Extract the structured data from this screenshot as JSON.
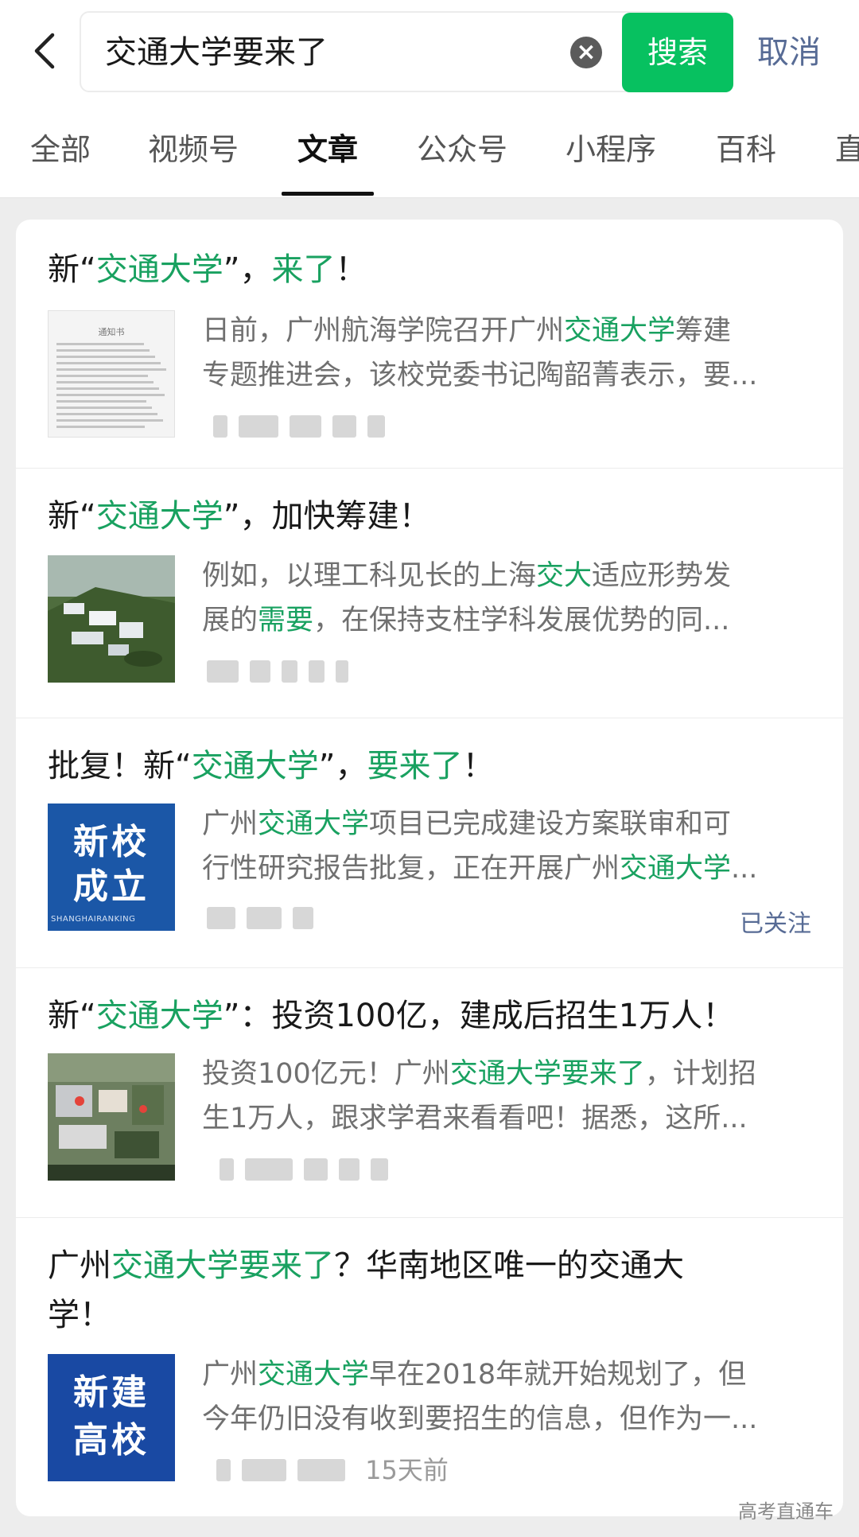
{
  "search": {
    "query": "交通大学要来了",
    "button": "搜索",
    "cancel": "取消"
  },
  "tabs": [
    "全部",
    "视频号",
    "文章",
    "公众号",
    "小程序",
    "百科",
    "直"
  ],
  "active_tab": "文章",
  "results": [
    {
      "title": [
        [
          "新“",
          0
        ],
        [
          "交通大学",
          1
        ],
        [
          "”，",
          0
        ],
        [
          "来了",
          1
        ],
        [
          "！",
          0
        ]
      ],
      "desc": [
        [
          [
            "日前，广州航海学院召开广州",
            0
          ],
          [
            "交通大学",
            1
          ],
          [
            "筹建",
            0
          ]
        ],
        [
          [
            "专题推进会，该校党委书记陶韶菁表示，要...",
            0
          ]
        ]
      ],
      "thumb": "doc",
      "thumb_text": [
        "通知书"
      ]
    },
    {
      "title": [
        [
          "新“",
          0
        ],
        [
          "交通大学",
          1
        ],
        [
          "”，加快筹建！",
          0
        ]
      ],
      "desc": [
        [
          [
            "例如，以理工科见长的上海",
            0
          ],
          [
            "交大",
            1
          ],
          [
            "适应形势发",
            0
          ]
        ],
        [
          [
            "展的",
            0
          ],
          [
            "需要",
            1
          ],
          [
            "，在保持支柱学科发展优势的同...",
            0
          ]
        ]
      ],
      "thumb": "campus"
    },
    {
      "title": [
        [
          "批复！新“",
          0
        ],
        [
          "交通大学",
          1
        ],
        [
          "”，",
          0
        ],
        [
          "要来了",
          1
        ],
        [
          "！",
          0
        ]
      ],
      "desc": [
        [
          [
            "广州",
            0
          ],
          [
            "交通大学",
            1
          ],
          [
            "项目已完成建设方案联审和可",
            0
          ]
        ],
        [
          [
            "行性研究报告批复，正在开展广州",
            0
          ],
          [
            "交通大学",
            1
          ],
          [
            "...",
            0
          ]
        ]
      ],
      "thumb": "badge",
      "thumb_text": [
        "新校",
        "成立"
      ],
      "thumb_caption": "SHANGHAIRANKING",
      "followed": "已关注"
    },
    {
      "title": [
        [
          "新“",
          0
        ],
        [
          "交通大学",
          1
        ],
        [
          "”：投资100亿，建成后招生1万人！",
          0
        ]
      ],
      "desc": [
        [
          [
            "投资100亿元！广州",
            0
          ],
          [
            "交通大学要来了",
            1
          ],
          [
            "，计划招",
            0
          ]
        ],
        [
          [
            "生1万人，跟求学君来看看吧！据悉，这所...",
            0
          ]
        ]
      ],
      "thumb": "campus2"
    },
    {
      "title": [
        [
          "广州",
          0
        ],
        [
          "交通大学要来了",
          1
        ],
        [
          "？华南地区唯一的交通大",
          0
        ]
      ],
      "title2": "学！",
      "desc": [
        [
          [
            "广州",
            0
          ],
          [
            "交通大学",
            1
          ],
          [
            "早在2018年就开始规划了，但",
            0
          ]
        ],
        [
          [
            "今年仍旧没有收到要招生的信息，但作为一...",
            0
          ]
        ]
      ],
      "thumb": "badge2",
      "thumb_text": [
        "新建",
        "高校"
      ],
      "time": "15天前"
    }
  ],
  "watermark": "高考直通车",
  "colors": {
    "accent": "#07c160",
    "highlight": "#19a160",
    "link": "#576b95"
  }
}
